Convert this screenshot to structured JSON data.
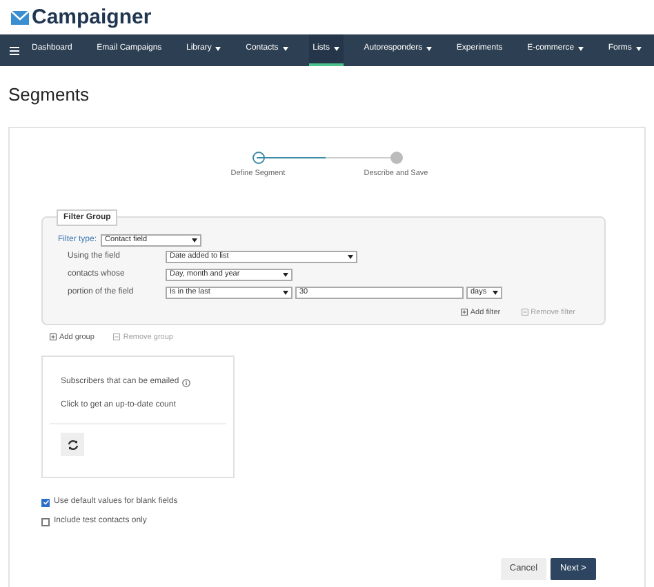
{
  "logo": {
    "text": "Campaigner"
  },
  "nav": [
    {
      "label": "Dashboard",
      "dropdown": false,
      "selected": false
    },
    {
      "label": "Email Campaigns",
      "dropdown": false,
      "selected": false
    },
    {
      "label": "Library",
      "dropdown": true,
      "selected": false
    },
    {
      "label": "Contacts",
      "dropdown": true,
      "selected": false
    },
    {
      "label": "Lists",
      "dropdown": true,
      "selected": true
    },
    {
      "label": "Autoresponders",
      "dropdown": true,
      "selected": false
    },
    {
      "label": "Experiments",
      "dropdown": false,
      "selected": false
    },
    {
      "label": "E-commerce",
      "dropdown": true,
      "selected": false
    },
    {
      "label": "Forms",
      "dropdown": true,
      "selected": false
    }
  ],
  "page_title": "Segments",
  "steps": [
    {
      "label": "Define Segment",
      "selected": true
    },
    {
      "label": "Describe and Save",
      "selected": false
    }
  ],
  "filter_group": {
    "legend": "Filter Group",
    "filter_type_label": "Filter type:",
    "filter_type": "Contact field",
    "rows": [
      {
        "label": "Using the field",
        "controls": [
          {
            "kind": "select",
            "value": "Date added to list"
          }
        ]
      },
      {
        "label": "contacts whose",
        "controls": [
          {
            "kind": "select",
            "value": "Day, month and year"
          }
        ]
      },
      {
        "label": "portion of the field",
        "controls": [
          {
            "kind": "select",
            "value": "Is in the last"
          },
          {
            "kind": "input",
            "value": "30"
          },
          {
            "kind": "select",
            "value": "days"
          }
        ]
      }
    ],
    "actions": [
      {
        "label": "Add filter",
        "disabled": false
      },
      {
        "label": "Remove filter",
        "disabled": true
      }
    ]
  },
  "group_actions": [
    {
      "label": "Add group",
      "disabled": false
    },
    {
      "label": "Remove group",
      "disabled": true
    }
  ],
  "count_card": {
    "title": "Subscribers that can be emailed",
    "hint": "Click to get an up-to-date count"
  },
  "options": [
    {
      "label": "Use default values for blank fields",
      "checked": true
    },
    {
      "label": "Include test contacts only",
      "checked": false
    }
  ],
  "buttons": [
    {
      "label": "Cancel",
      "kind": "secondary"
    },
    {
      "label": "Next >",
      "kind": "primary"
    }
  ]
}
